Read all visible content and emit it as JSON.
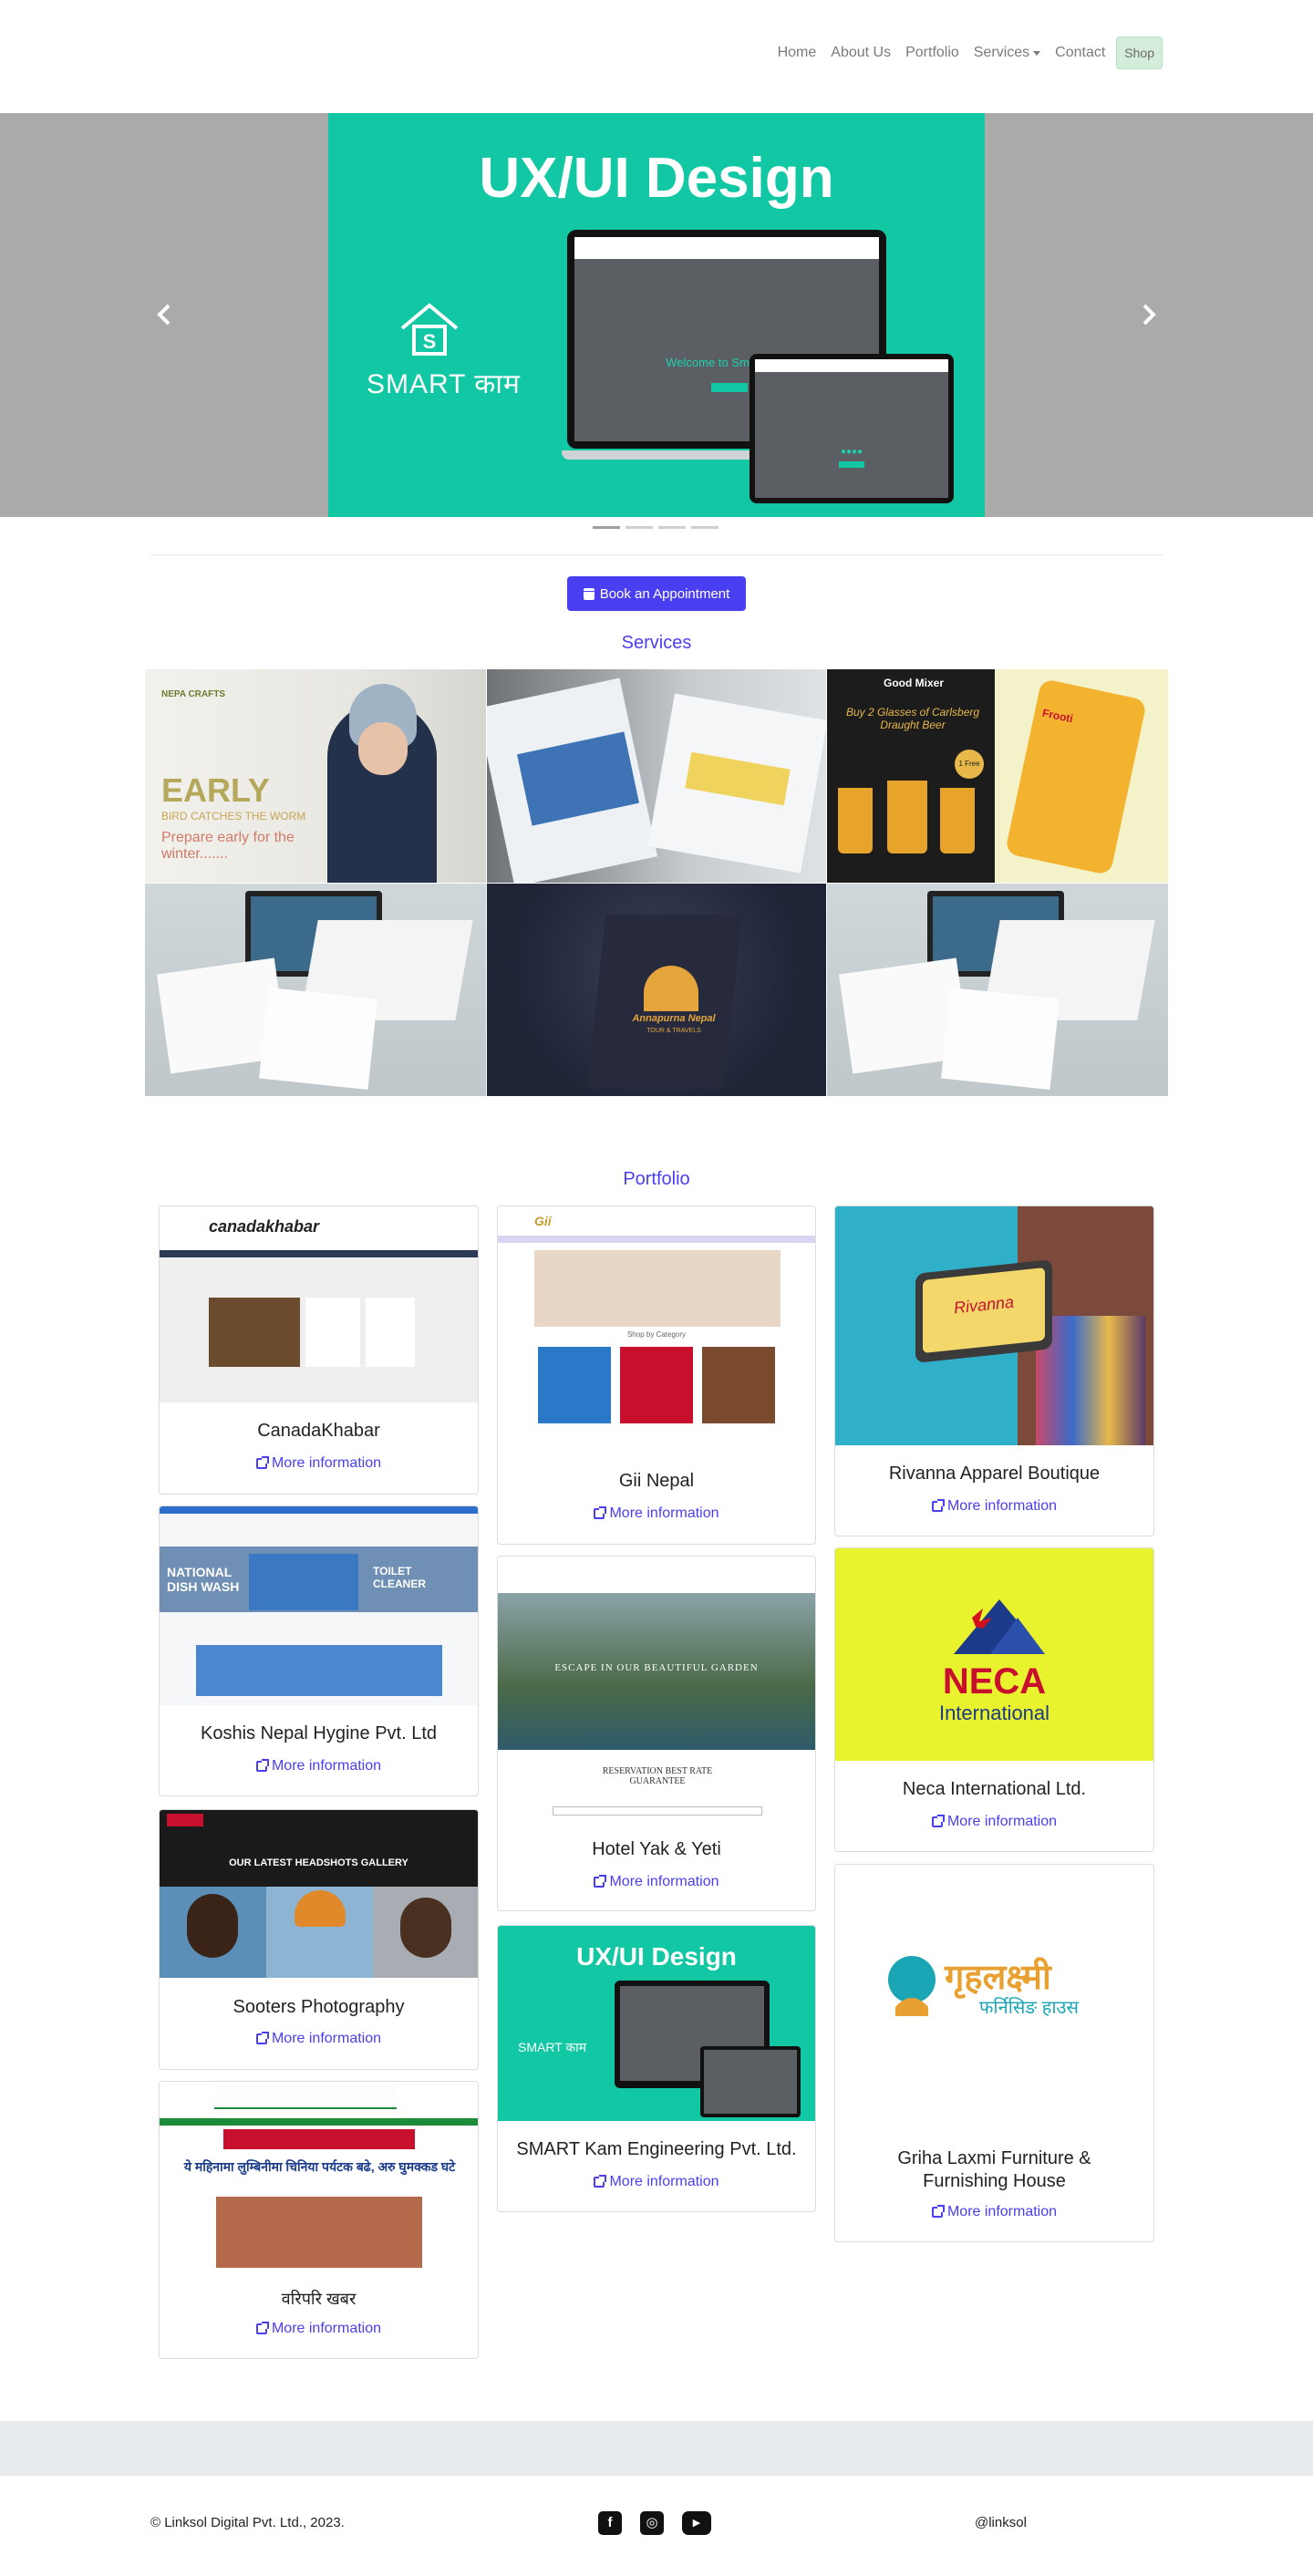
{
  "nav": {
    "items": [
      "Home",
      "About Us",
      "Portfolio",
      "Services",
      "Contact"
    ],
    "shop_label": "Shop"
  },
  "carousel": {
    "slide_title": "UX/UI Design",
    "slide_brand": "SMART काम",
    "welcome_text": "Welcome to SmartKam",
    "prev_icon": "chevron-left-icon",
    "next_icon": "chevron-right-icon",
    "indicator_count": 4
  },
  "book_button_label": "Book an Appointment",
  "services_title": "Services",
  "services_images": {
    "s1": {
      "brand": "NEPA CRAFTS",
      "line1": "EARLY",
      "line2": "BIRD CATCHES THE WORM",
      "line3": "Prepare early for the winter......."
    },
    "s3": {
      "brand": "Good Mixer",
      "line1": "Buy 2 Glasses of Carlsberg Draught Beer",
      "badge": "1 Free",
      "product": "Frooti"
    },
    "s5": {
      "brand": "Annapurna Nepal",
      "sub": "TOUR & TRAVELS"
    }
  },
  "portfolio_title": "Portfolio",
  "portfolio": [
    {
      "id": "canadakhabar",
      "title": "CanadaKhabar",
      "more": "More information",
      "thumb": "canadakhabar"
    },
    {
      "id": "koshis",
      "title": "Koshis Nepal Hygine Pvt. Ltd",
      "more": "More information",
      "thumb": "NATIONAL DISH WASH",
      "thumb2": "TOILET CLEANER"
    },
    {
      "id": "sooters",
      "title": "Sooters Photography",
      "more": "More information",
      "thumb": "OUR LATEST HEADSHOTS GALLERY"
    },
    {
      "id": "nepali",
      "title": "वरिपरि खबर",
      "more": "More information",
      "thumb": "ये महिनामा लुम्बिनीमा चिनिया पर्यटक बढे, अरु घुमक्कड घटे"
    },
    {
      "id": "giinepal",
      "title": "Gii Nepal",
      "more": "More information",
      "thumb": "Shop by Category"
    },
    {
      "id": "hotelyak",
      "title": "Hotel Yak & Yeti",
      "more": "More information",
      "thumb": "ESCAPE IN OUR BEAUTIFUL GARDEN",
      "thumb2": "RESERVATION BEST RATE GUARANTEE"
    },
    {
      "id": "smartkam",
      "title": "SMART Kam Engineering Pvt. Ltd.",
      "more": "More information",
      "thumb": "UX/UI Design",
      "thumb2": "SMART काम"
    },
    {
      "id": "rivanna",
      "title": "Rivanna Apparel Boutique",
      "more": "More information",
      "thumb": "Rivanna"
    },
    {
      "id": "neca",
      "title": "Neca International Ltd.",
      "more": "More information",
      "thumb": "NECA",
      "thumb2": "International"
    },
    {
      "id": "grihalaxmi",
      "title": "Griha Laxmi Furniture & Furnishing House",
      "more": "More information",
      "thumb": "गृहलक्ष्मी",
      "thumb2": "फर्निसिङ हाउस"
    }
  ],
  "footer": {
    "copyright": "© Linksol Digital Pvt. Ltd., 2023.",
    "social": [
      "facebook-icon",
      "instagram-icon",
      "youtube-icon"
    ],
    "handle": "@linksol"
  },
  "colors": {
    "accent": "#4a3ff0",
    "teal": "#12c7a3",
    "neca_bg": "#e8f22d",
    "footer_band": "#e8ebee"
  }
}
